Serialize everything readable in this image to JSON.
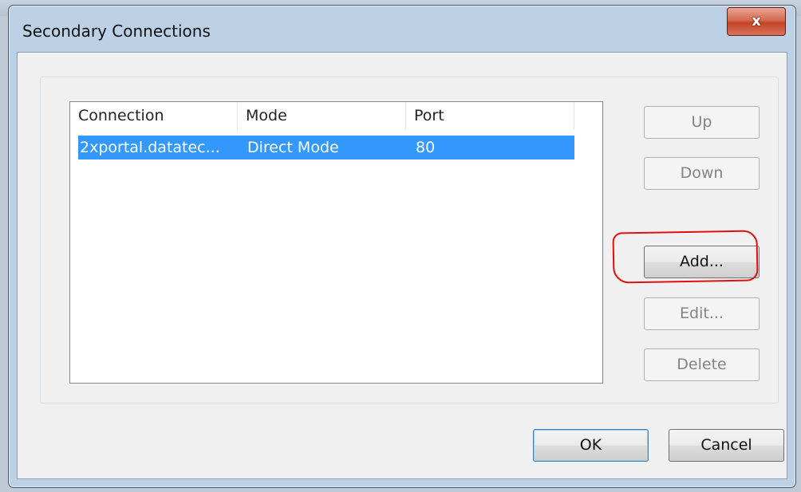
{
  "window": {
    "title": "Secondary Connections",
    "close_label": "x"
  },
  "listview": {
    "columns": [
      "Connection",
      "Mode",
      "Port"
    ],
    "rows": [
      {
        "connection": "2xportal.datatec...",
        "mode": "Direct Mode",
        "port": "80"
      }
    ]
  },
  "side_buttons": {
    "up": "Up",
    "down": "Down",
    "add": "Add...",
    "edit": "Edit...",
    "delete": "Delete"
  },
  "footer_buttons": {
    "ok": "OK",
    "cancel": "Cancel"
  },
  "colors": {
    "selection": "#3399ff",
    "annotation": "#e01010",
    "close_button": "#c24428"
  }
}
